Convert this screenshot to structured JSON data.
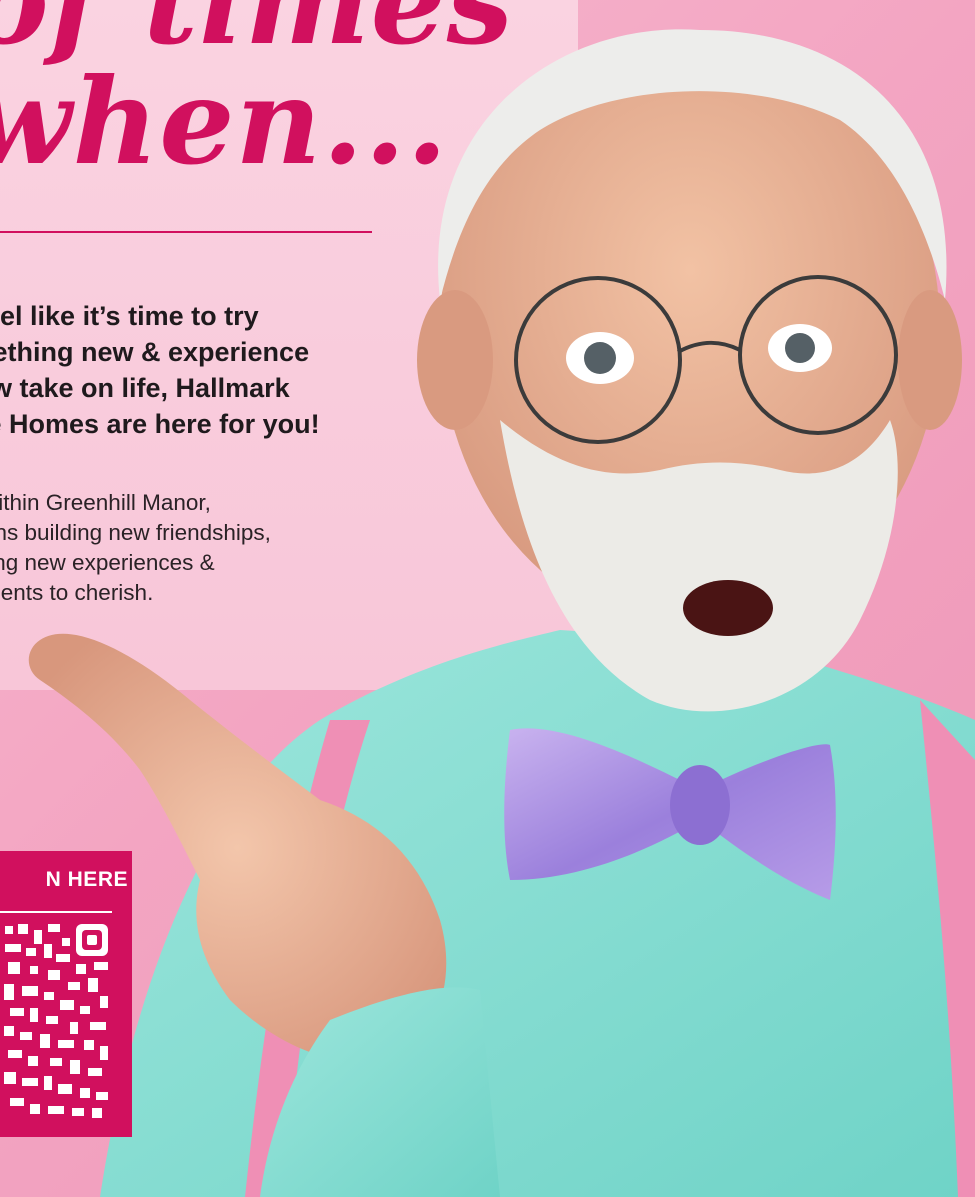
{
  "headline": {
    "line1": "of times",
    "line2": "when..."
  },
  "tagline": "feel like it’s time to try\nnething new & experience\new take on life, Hallmark\nre Homes are here for you!",
  "body_copy": "within Greenhill Manor,\nans building new friendships,\nting new experiences &\nments to cherish.",
  "qr": {
    "label": "N HERE"
  },
  "colors": {
    "brand": "#d1105e",
    "panel": "#f9cfdf",
    "background": "#f3a5c2"
  },
  "photo": {
    "description_icon": "senior-man-pointing-photo"
  }
}
